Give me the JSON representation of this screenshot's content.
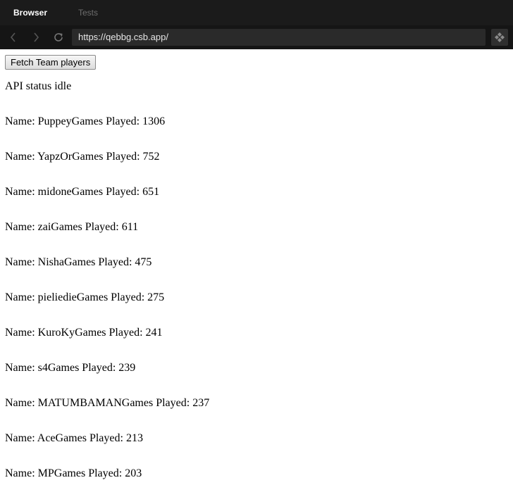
{
  "tabs": [
    {
      "label": "Browser",
      "active": true
    },
    {
      "label": "Tests",
      "active": false
    }
  ],
  "browser": {
    "url": "https://qebbg.csb.app/"
  },
  "page": {
    "fetch_button_label": "Fetch Team players",
    "status_text": "API status idle",
    "players": [
      {
        "text": "Name: PuppeyGames Played: 1306"
      },
      {
        "text": "Name: YapzOrGames Played: 752"
      },
      {
        "text": "Name: midoneGames Played: 651"
      },
      {
        "text": "Name: zaiGames Played: 611"
      },
      {
        "text": "Name: NishaGames Played: 475"
      },
      {
        "text": "Name: pieliedieGames Played: 275"
      },
      {
        "text": "Name: KuroKyGames Played: 241"
      },
      {
        "text": "Name: s4Games Played: 239"
      },
      {
        "text": "Name: MATUMBAMANGames Played: 237"
      },
      {
        "text": "Name: AceGames Played: 213"
      },
      {
        "text": "Name: MPGames Played: 203"
      }
    ]
  }
}
